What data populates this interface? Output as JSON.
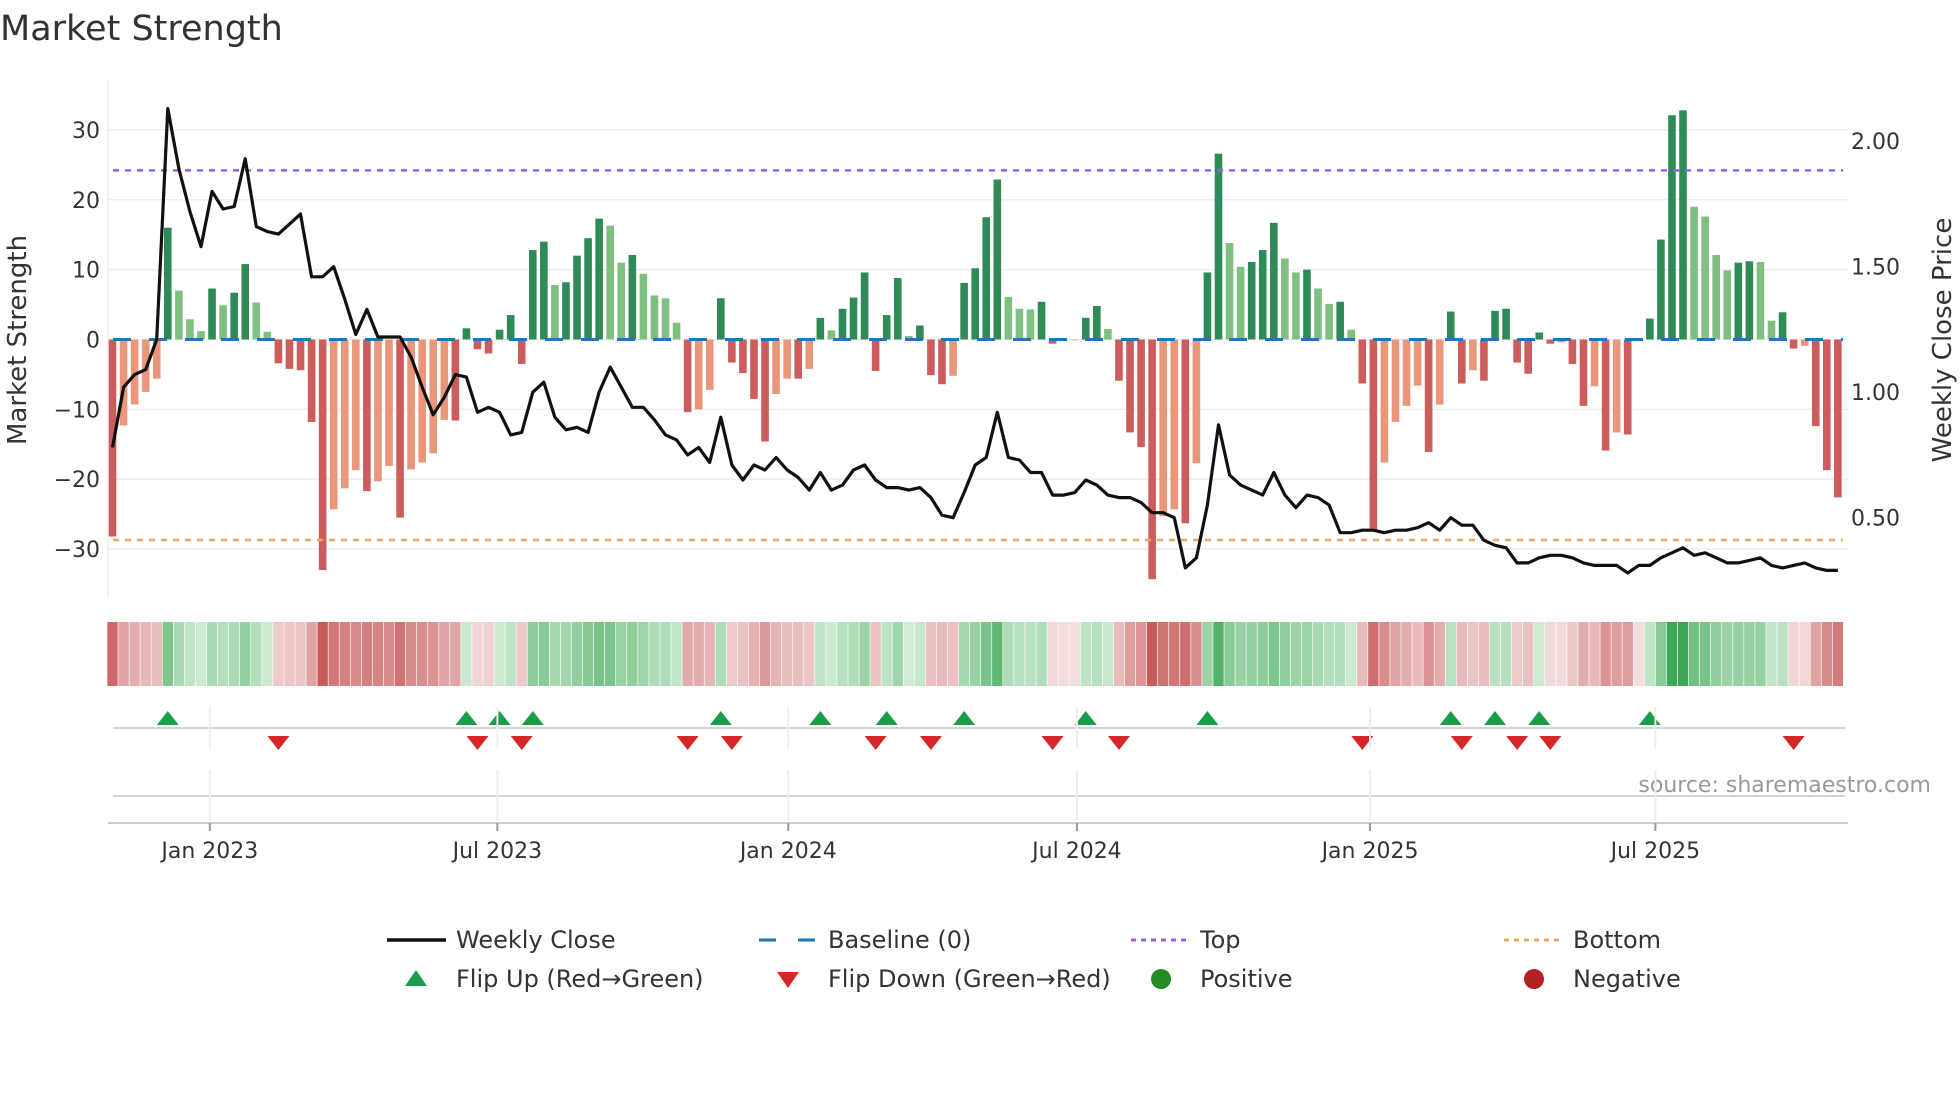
{
  "chart_data": {
    "type": "bar",
    "title": "Market Strength",
    "ylabel": "Market Strength",
    "y2label": "Weekly Close Price",
    "ylim": [
      -37,
      37
    ],
    "y2lim": [
      0.18,
      2.24
    ],
    "yticks": [
      -30,
      -20,
      -10,
      0,
      10,
      20,
      30
    ],
    "ytick_labels": [
      "−30",
      "−20",
      "−10",
      "0",
      "10",
      "20",
      "30"
    ],
    "y2ticks": [
      0.5,
      1.0,
      1.5,
      2.0
    ],
    "y2tick_labels": [
      "0.50",
      "1.00",
      "1.50",
      "2.00"
    ],
    "x_ticks": [
      {
        "label": "Jan 2023",
        "week": 8.8
      },
      {
        "label": "Jul 2023",
        "week": 34.8
      },
      {
        "label": "Jan 2024",
        "week": 61.1
      },
      {
        "label": "Jul 2024",
        "week": 87.2
      },
      {
        "label": "Jan 2025",
        "week": 113.7
      },
      {
        "label": "Jul 2025",
        "week": 139.5
      }
    ],
    "top_level": 24.2,
    "bottom_level": -28.7,
    "baseline": 0,
    "strength": [
      -28.2,
      -12.3,
      -9.3,
      -7.5,
      -5.6,
      16,
      7,
      2.9,
      1.2,
      7.3,
      4.9,
      6.7,
      10.8,
      5.3,
      1.1,
      -3.4,
      -4.2,
      -4.4,
      -11.8,
      -33,
      -24.3,
      -21.3,
      -18.7,
      -21.7,
      -20.3,
      -18.1,
      -25.5,
      -18.6,
      -17.6,
      -16.3,
      -11.5,
      -11.6,
      1.6,
      -1.4,
      -2,
      1.4,
      3.5,
      -3.5,
      12.8,
      14,
      7.8,
      8.2,
      12,
      14.5,
      17.3,
      16.3,
      11,
      12.1,
      9.4,
      6.3,
      5.9,
      2.4,
      -10.4,
      -10,
      -7.2,
      5.9,
      -3.3,
      -4.8,
      -8.5,
      -14.6,
      -7.8,
      -5.6,
      -5.6,
      -4.2,
      3.1,
      1.3,
      4.4,
      6,
      9.6,
      -4.5,
      3.5,
      8.8,
      0.5,
      2,
      -5.1,
      -6.4,
      -5.2,
      8.1,
      10.2,
      17.5,
      22.9,
      6.1,
      4.4,
      4.3,
      5.4,
      -0.6,
      -0.2,
      -0.1,
      3.1,
      4.8,
      1.5,
      -5.9,
      -13.3,
      -15.4,
      -34.3,
      -25.3,
      -24.3,
      -26.3,
      -17.7,
      9.6,
      26.6,
      13.8,
      10.4,
      11.1,
      12.8,
      16.7,
      11.6,
      9.6,
      10,
      7.3,
      5.1,
      5.4,
      1.4,
      -6.3,
      -27.3,
      -17.6,
      -11.8,
      -9.5,
      -6.6,
      -16.1,
      -9.3,
      4,
      -6.3,
      -4.4,
      -5.9,
      4.1,
      4.4,
      -3.3,
      -4.9,
      1,
      -0.6,
      -0.4,
      -3.5,
      -9.5,
      -6.7,
      -15.9,
      -13.3,
      -13.6,
      -0.1,
      3,
      14.3,
      32.1,
      32.8,
      19,
      17.6,
      12.1,
      9.9,
      11,
      11.2,
      11.1,
      2.7,
      3.9,
      -1.3,
      -0.9,
      -12.4,
      -18.7,
      -22.6
    ],
    "weekly_close": [
      0.78,
      1.02,
      1.07,
      1.09,
      1.21,
      2.13,
      1.89,
      1.72,
      1.58,
      1.8,
      1.73,
      1.74,
      1.93,
      1.66,
      1.64,
      1.63,
      1.67,
      1.71,
      1.46,
      1.46,
      1.5,
      1.37,
      1.23,
      1.33,
      1.22,
      1.22,
      1.22,
      1.14,
      1.02,
      0.91,
      0.98,
      1.07,
      1.06,
      0.92,
      0.94,
      0.92,
      0.83,
      0.84,
      1.0,
      1.04,
      0.9,
      0.85,
      0.86,
      0.84,
      1.0,
      1.1,
      1.02,
      0.94,
      0.94,
      0.89,
      0.83,
      0.81,
      0.75,
      0.78,
      0.72,
      0.9,
      0.71,
      0.65,
      0.71,
      0.69,
      0.74,
      0.69,
      0.66,
      0.61,
      0.68,
      0.61,
      0.63,
      0.69,
      0.71,
      0.65,
      0.62,
      0.62,
      0.61,
      0.62,
      0.58,
      0.51,
      0.5,
      0.6,
      0.71,
      0.74,
      0.92,
      0.74,
      0.73,
      0.68,
      0.68,
      0.59,
      0.59,
      0.6,
      0.65,
      0.63,
      0.59,
      0.58,
      0.58,
      0.56,
      0.52,
      0.52,
      0.5,
      0.3,
      0.34,
      0.55,
      0.87,
      0.67,
      0.63,
      0.61,
      0.59,
      0.68,
      0.59,
      0.54,
      0.59,
      0.58,
      0.55,
      0.44,
      0.44,
      0.45,
      0.45,
      0.44,
      0.45,
      0.45,
      0.46,
      0.48,
      0.45,
      0.5,
      0.47,
      0.47,
      0.41,
      0.39,
      0.38,
      0.32,
      0.32,
      0.34,
      0.35,
      0.35,
      0.34,
      0.32,
      0.31,
      0.31,
      0.31,
      0.28,
      0.31,
      0.31,
      0.34,
      0.36,
      0.38,
      0.35,
      0.36,
      0.34,
      0.32,
      0.32,
      0.33,
      0.34,
      0.31,
      0.3,
      0.31,
      0.32,
      0.3,
      0.29,
      0.29
    ],
    "colors": {
      "pos_strong": "#2e8b57",
      "pos_weak": "#7fbf7f",
      "neg_strong": "#cd5c5c",
      "neg_weak": "#e9967a",
      "line": "#111111",
      "baseline": "#1f77b4",
      "top": "#9b5de5",
      "bottom": "#f4a460",
      "flip_up": "#1a9e4a",
      "flip_down": "#d62728",
      "positive": "#228b22",
      "negative": "#b22222"
    },
    "legend": {
      "placement": "bottom",
      "items": [
        {
          "key": "close",
          "label": "Weekly Close"
        },
        {
          "key": "baseline",
          "label": "Baseline (0)"
        },
        {
          "key": "top",
          "label": "Top"
        },
        {
          "key": "bottom",
          "label": "Bottom"
        },
        {
          "key": "flip_up",
          "label": "Flip Up (Red→Green)"
        },
        {
          "key": "flip_down",
          "label": "Flip Down (Green→Red)"
        },
        {
          "key": "positive",
          "label": "Positive"
        },
        {
          "key": "negative",
          "label": "Negative"
        }
      ]
    },
    "source": "source: sharemaestro.com"
  }
}
